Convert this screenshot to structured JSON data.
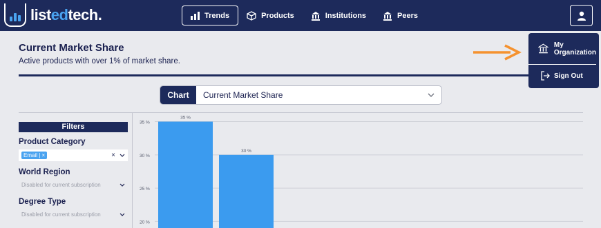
{
  "brand": {
    "prefix": "list",
    "highlight": "ed",
    "suffix": "tech."
  },
  "nav": [
    {
      "label": "Trends",
      "icon": "bar-chart-icon",
      "active": true
    },
    {
      "label": "Products",
      "icon": "cube-icon",
      "active": false
    },
    {
      "label": "Institutions",
      "icon": "bank-icon",
      "active": false
    },
    {
      "label": "Peers",
      "icon": "bank-icon",
      "active": false
    }
  ],
  "user_menu": {
    "org_line1": "My",
    "org_line2": "Organization",
    "sign_out": "Sign Out"
  },
  "page": {
    "title": "Current Market Share",
    "subtitle": "Active products with over 1% of market share."
  },
  "chart_selector": {
    "tag": "Chart",
    "value": "Current Market Share"
  },
  "filters": {
    "heading": "Filters",
    "product_category": {
      "label": "Product Category",
      "chip": "Email | ×"
    },
    "world_region": {
      "label": "World Region",
      "placeholder": "Disabled for current subscription"
    },
    "degree_type": {
      "label": "Degree Type",
      "placeholder": "Disabled for current subscription"
    }
  },
  "colors": {
    "navy": "#1d2a5b",
    "accent": "#4aa3f0",
    "arrow": "#f5922f",
    "bar": "#3b9bef"
  },
  "chart_data": {
    "type": "bar",
    "title": "",
    "xlabel": "",
    "ylabel": "",
    "categories": [
      "",
      ""
    ],
    "values": [
      35,
      30
    ],
    "value_labels": [
      "35 %",
      "30 %"
    ],
    "yticks": [
      "35 %",
      "30 %",
      "25 %",
      "20 %"
    ],
    "ytick_values": [
      35,
      30,
      25,
      20
    ],
    "ylim_visible": [
      19,
      36.3
    ],
    "grid": true
  }
}
